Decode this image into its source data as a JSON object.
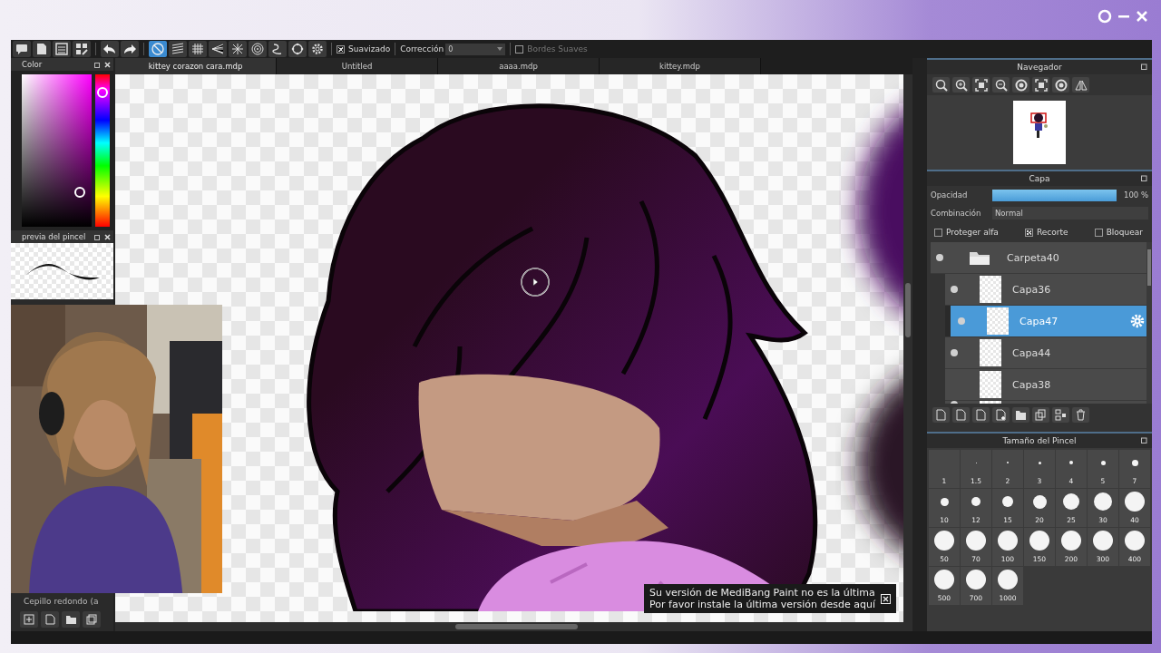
{
  "toolbar": {
    "snap_modes": [
      {
        "selected": true
      },
      {
        "selected": false
      },
      {
        "selected": false
      },
      {
        "selected": false
      },
      {
        "selected": false
      },
      {
        "selected": false
      },
      {
        "selected": false
      },
      {
        "selected": false
      }
    ],
    "smoothing": {
      "label": "Suavizado",
      "checked": true
    },
    "correction": {
      "label": "Corrección",
      "value": "0"
    },
    "soft_edges": {
      "label": "Bordes Suaves",
      "checked": false
    }
  },
  "color_panel": {
    "title": "Color",
    "hue": {
      "level": 0.88
    }
  },
  "brush_preview": {
    "title": "previa del pincel"
  },
  "brush_list": {
    "current": "Cepillo redondo (a"
  },
  "document_tabs": [
    {
      "label": "kittey corazon cara.mdp",
      "selected": true
    },
    {
      "label": "Untitled",
      "selected": false
    },
    {
      "label": "aaaa.mdp",
      "selected": false
    },
    {
      "label": "kittey.mdp",
      "selected": false
    }
  ],
  "notification": {
    "lines": [
      "Su versión de MediBang Paint no es la última",
      "Por favor instale la última versión desde aquí"
    ]
  },
  "navigator": {
    "title": "Navegador"
  },
  "layer_panel": {
    "title": "Capa",
    "opacity": {
      "label": "Opacidad",
      "level": 1,
      "reading": "100 %"
    },
    "blend": {
      "label": "Combinación",
      "value": "Normal"
    },
    "options": [
      {
        "label": "Proteger alfa",
        "checked": false
      },
      {
        "label": "Recorte",
        "checked": true
      },
      {
        "label": "Bloquear",
        "checked": false
      }
    ],
    "layers": [
      {
        "name": "Carpeta40",
        "kind": "folder",
        "visible": true,
        "selected": false,
        "children": [
          {
            "name": "Capa36",
            "kind": "layer",
            "visible": true,
            "selected": false,
            "clipped": false
          },
          {
            "name": "Capa47",
            "kind": "layer",
            "visible": true,
            "selected": true,
            "clipped": true
          },
          {
            "name": "Capa44",
            "kind": "layer",
            "visible": true,
            "selected": false,
            "clipped": false
          },
          {
            "name": "Capa38",
            "kind": "layer",
            "visible": false,
            "selected": false,
            "clipped": false
          }
        ]
      }
    ]
  },
  "brush_size": {
    "title": "Tamaño del Pincel",
    "sizes": [
      "1",
      "1.5",
      "2",
      "3",
      "4",
      "5",
      "7",
      "10",
      "12",
      "15",
      "20",
      "25",
      "30",
      "40",
      "50",
      "70",
      "100",
      "150",
      "200",
      "300",
      "400",
      "500",
      "700",
      "1000"
    ]
  }
}
